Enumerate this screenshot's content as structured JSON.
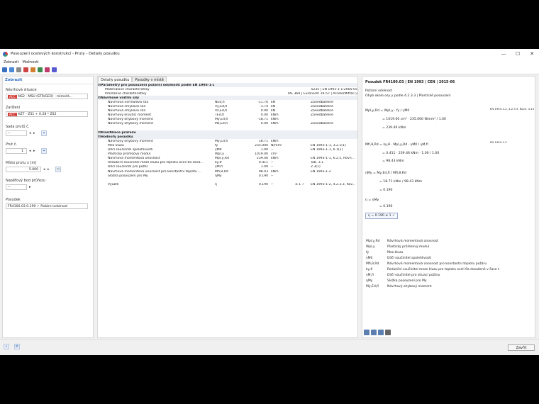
{
  "window": {
    "title": "Posouzení ocelových konstrukcí - Pruty - Detaily posudku",
    "min": "—",
    "max": "☐",
    "close": "✕"
  },
  "menu": [
    "Zobrazit",
    "Možnosti"
  ],
  "left": {
    "header": "Zobrazit",
    "situace_label": "Návrhová situace",
    "situace_tag": "ACC",
    "situace_value": "NS2 - MSÚ (STR/GEO) - mimořá...",
    "zatizeni_label": "Zatížení",
    "zatizeni_tag": "ACC",
    "zatizeni_value": "KZ7 - ZS1 + 0.28 * ZS2",
    "sada_label": "Sada prutů č.",
    "sada_value": "--",
    "prut_label": "Prut č.",
    "prut_value": "1",
    "misto_label": "Místo prutu x [m]",
    "misto_value": "5.000",
    "misto_unit": "m",
    "bod_label": "Napěťový bod průřezu",
    "bod_value": "--",
    "posudek_label": "Posudek",
    "posudek_value": "FR4100.03  0.190 ✓  Požární odolnost"
  },
  "tabs": [
    "Detaily posudku",
    "Posudky v místě"
  ],
  "rows": [
    {
      "t": "g",
      "a": "Parametry pro posouzení požární odolnosti podle EN 1993-1-2 a EN 1993-1-2",
      "d": "",
      "e": "",
      "f": ""
    },
    {
      "t": "n",
      "a": "Materiálové charakteristiky",
      "b": "",
      "c": "",
      "d": "S235 | EN 1993-1-1:2005-05",
      "e": "",
      "f": ""
    },
    {
      "t": "n",
      "a": "Průřezové charakteristiky",
      "b": "",
      "c": "",
      "d": "IPE 360 | Euronorm 19-57 | ArcelorMittal (2011)",
      "e": "",
      "f": ""
    },
    {
      "t": "g",
      "a": "Návrhové vnitřní síly",
      "d": "",
      "e": "",
      "f": ""
    },
    {
      "t": "i",
      "a": "Návrhová normálová síla",
      "b": "NEd,fi",
      "c": "-11.76",
      "u": "kN",
      "f": "Zanedbatelné"
    },
    {
      "t": "i",
      "a": "Návrhová smyková síla",
      "b": "Vy,Ed,fi",
      "c": "-3.74",
      "u": "kN",
      "f": "Zanedbatelné"
    },
    {
      "t": "i",
      "a": "Návrhová smyková síla",
      "b": "Vz,Ed,fi",
      "c": "0.00",
      "u": "kN",
      "f": "Zanedbatelné"
    },
    {
      "t": "i",
      "a": "Návrhový kroutící moment",
      "b": "TEd,fi",
      "c": "0.00",
      "u": "kNm",
      "f": "Zanedbatelné"
    },
    {
      "t": "i",
      "a": "Návrhový ohybový moment",
      "b": "My,Ed,fi",
      "c": "-18.71",
      "u": "kNm",
      "f": ""
    },
    {
      "t": "i",
      "a": "Návrhový ohybový moment",
      "b": "Mz,Ed,fi",
      "c": "0.00",
      "u": "kNm",
      "f": "Zanedbatelné"
    },
    {
      "t": "s",
      "a": "",
      "f": ""
    },
    {
      "t": "g",
      "a": "Klasifikace průřezu",
      "d": "",
      "e": "",
      "f": ""
    },
    {
      "t": "g",
      "a": "Hodnoty posudku",
      "d": "",
      "e": "",
      "f": ""
    },
    {
      "t": "i",
      "a": "Návrhový ohybový moment",
      "b": "My,Ed,fi",
      "c": "18.71",
      "u": "kNm",
      "f": ""
    },
    {
      "t": "i",
      "a": "Mez kluzu",
      "b": "fy",
      "c": "235.000",
      "u": "N/mm²",
      "f": "EN 1993-1-1, 3.2.1(1)"
    },
    {
      "t": "i",
      "a": "Dílčí součinitel spolehlivosti",
      "b": "γM0",
      "c": "1.00",
      "u": "--",
      "f": "EN 1993-1-1, 6.1(1)"
    },
    {
      "t": "i",
      "a": "Plastický průřezový modul",
      "b": "Wpl,y",
      "c": "1019.00",
      "u": "cm³",
      "f": ""
    },
    {
      "t": "i",
      "a": "Návrhová momentová únosnost",
      "b": "Mpl,y,Rd",
      "c": "239.46",
      "u": "kNm",
      "f": "EN 1993-1-1, 6.2.5, Rovn..."
    },
    {
      "t": "i",
      "a": "Redukční součinitel meze kluzu pro teplotu oceli θa dosa...",
      "b": "ky,θ",
      "c": "0.411",
      "u": "--",
      "f": "Tab. 3.1"
    },
    {
      "t": "i",
      "a": "Dílčí součinitel pro požár",
      "b": "γM,fi",
      "c": "1.00",
      "u": "--",
      "f": "2.3(1)"
    },
    {
      "t": "i",
      "a": "Návrhová momentová únosnost pro konstantní teplotu ...",
      "b": "Mfi,θ,Rd",
      "c": "98.43",
      "u": "kNm",
      "f": "EN 1993-1-2"
    },
    {
      "t": "i",
      "a": "Složka posouzení pro My",
      "b": "ηMy",
      "c": "0.190",
      "u": "--",
      "f": ""
    },
    {
      "t": "s",
      "a": "",
      "f": ""
    },
    {
      "t": "x",
      "a": "Využití",
      "b": "η",
      "c": "0.190",
      "u": "--",
      "e": "≤ 1 ✓",
      "f": "EN 1993-1-2, 4.2.3.3, Rov..."
    }
  ],
  "right": {
    "title": "Posudek FR4100.03 | EN 1993 | CEN | 2015-06",
    "sub1": "Požární odolnost",
    "sub2": "Ohyb okolo osy y podle 4.2.3.3 | Plastické posouzení",
    "ref1": "EN 1993-1-2, 4.2.3.3, Rovn. 4.15",
    "ref2": "EN 1993-1-2",
    "eq1a": "Mpl,y,Rd  =  Wpl,y · fy / γM0",
    "eq1b": "=  1019.00 cm³ · 235.000 N/mm² / 1.00",
    "eq1c": "=  239.46 kNm",
    "eq2a": "Mfi,θ,Rd  =  ky,θ · Mpl,y,Rd · γM0 / γM,fi",
    "eq2b": "=  0.411 · 239.46 kNm · 1.00 / 1.00",
    "eq2c": "=  98.43 kNm",
    "eq3a": "ηMy  =  My,Ed,fi / Mfi,θ,Rd",
    "eq3b": "=  18.71 kNm / 98.43 kNm",
    "eq3c": "=  0.190",
    "eq4a": "η  =  ηMy",
    "eq4b": "=  0.190",
    "result": "η  =  0.190  ≤ 1 ✓",
    "legend": [
      [
        "Mpl,y,Rd",
        "Návrhová momentová únosnost"
      ],
      [
        "Wpl,y",
        "Plastický průřezový modul"
      ],
      [
        "fy",
        "Mez kluzu"
      ],
      [
        "γM0",
        "Dílčí součinitel spolehlivosti"
      ],
      [
        "Mfi,θ,Rd",
        "Návrhová momentová únosnost pro konstantní teplotu požáru"
      ],
      [
        "ky,θ",
        "Redukční součinitel meze kluzu pro teplotu oceli θa dosažené v čase t"
      ],
      [
        "γM,fi",
        "Dílčí součinitel pro situaci požáru"
      ],
      [
        "ηMy",
        "Složka posouzení pro My"
      ],
      [
        "My,Ed,fi",
        "Návrhový ohybový moment"
      ]
    ]
  },
  "footer": {
    "close": "Zavřít"
  }
}
